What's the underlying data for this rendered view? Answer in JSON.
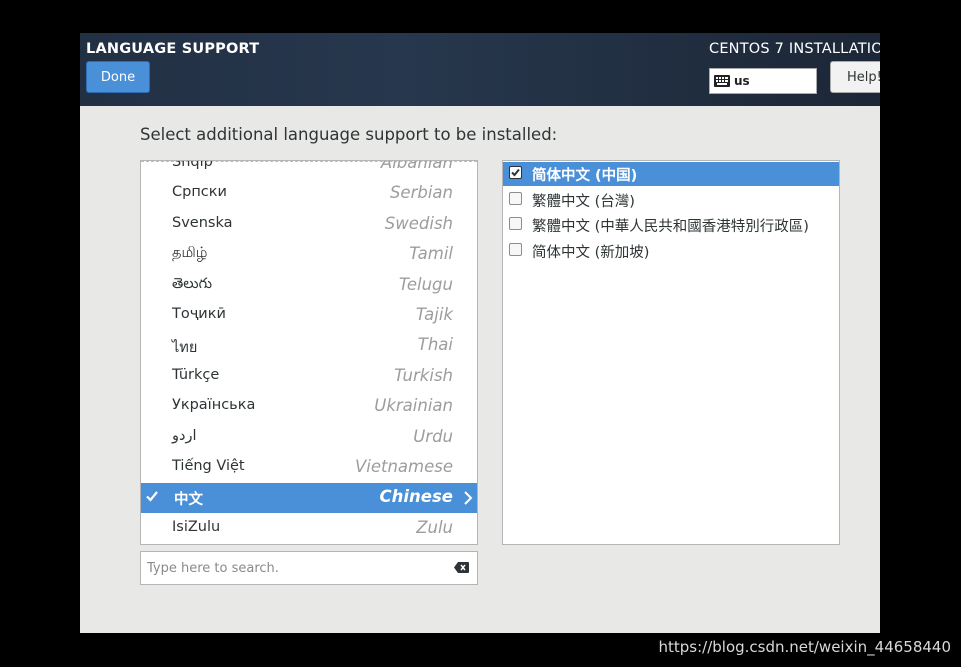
{
  "header": {
    "page_title": "LANGUAGE SUPPORT",
    "done_label": "Done",
    "product_title": "CENTOS 7 INSTALLATIO",
    "keyboard_layout": "us",
    "help_label": "Help!"
  },
  "instruction": "Select additional language support to be installed:",
  "languages": [
    {
      "native": "Shqip",
      "english": "Albanian",
      "selected": false
    },
    {
      "native": "Српски",
      "english": "Serbian",
      "selected": false
    },
    {
      "native": "Svenska",
      "english": "Swedish",
      "selected": false
    },
    {
      "native": "தமிழ்",
      "english": "Tamil",
      "selected": false
    },
    {
      "native": "తెలుగు",
      "english": "Telugu",
      "selected": false
    },
    {
      "native": "Тоҷикӣ",
      "english": "Tajik",
      "selected": false
    },
    {
      "native": "ไทย",
      "english": "Thai",
      "selected": false
    },
    {
      "native": "Türkçe",
      "english": "Turkish",
      "selected": false
    },
    {
      "native": "Українська",
      "english": "Ukrainian",
      "selected": false
    },
    {
      "native": "اردو",
      "english": "Urdu",
      "selected": false
    },
    {
      "native": "Tiếng Việt",
      "english": "Vietnamese",
      "selected": false
    },
    {
      "native": "中文",
      "english": "Chinese",
      "selected": true
    },
    {
      "native": "IsiZulu",
      "english": "Zulu",
      "selected": false
    }
  ],
  "search": {
    "placeholder": "Type here to search."
  },
  "locales": [
    {
      "label": "简体中文 (中国)",
      "checked": true
    },
    {
      "label": "繁體中文 (台灣)",
      "checked": false
    },
    {
      "label": "繁體中文 (中華人民共和國香港特別行政區)",
      "checked": false
    },
    {
      "label": "简体中文 (新加坡)",
      "checked": false
    }
  ],
  "watermark": "https://blog.csdn.net/weixin_44658440",
  "colors": {
    "accent": "#4a90d9",
    "header_bg": "#223044",
    "content_bg": "#e8e8e7"
  }
}
